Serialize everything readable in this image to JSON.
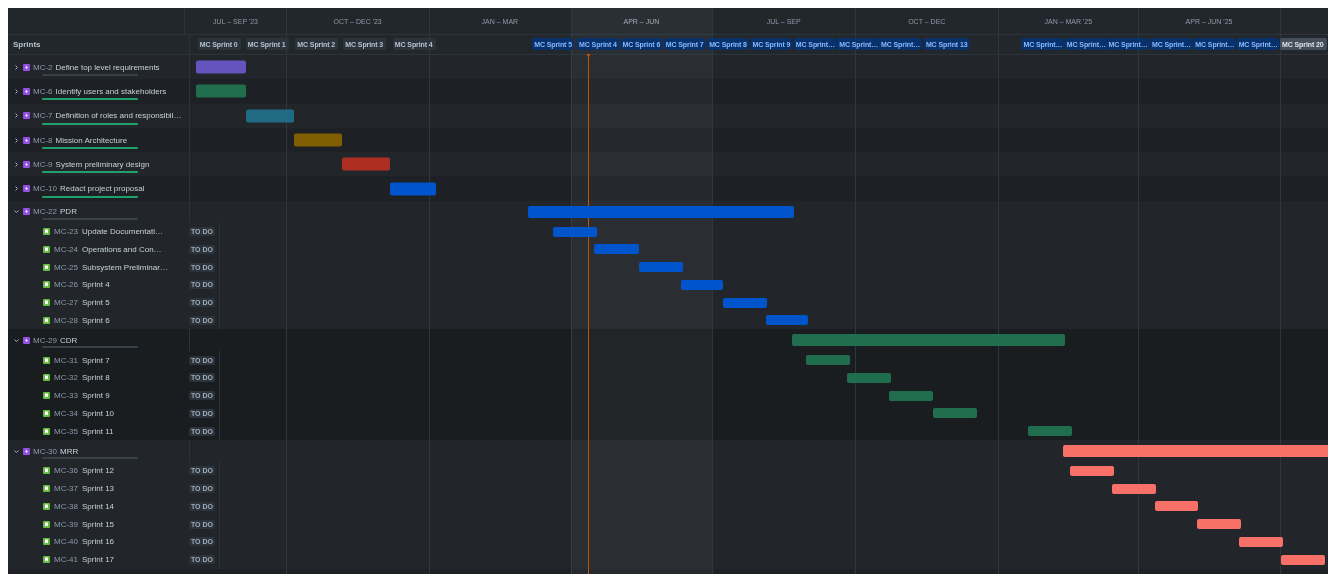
{
  "sprints_label": "Sprints",
  "quarters": [
    {
      "label": "JUL – SEP '23",
      "current": false
    },
    {
      "label": "OCT – DEC '23",
      "current": false
    },
    {
      "label": "JAN – MAR",
      "current": false
    },
    {
      "label": "APR – JUN",
      "current": true
    },
    {
      "label": "JUL – SEP",
      "current": false
    },
    {
      "label": "OCT – DEC",
      "current": false
    },
    {
      "label": "JAN – MAR '25",
      "current": false
    },
    {
      "label": "APR – JUN '25",
      "current": false
    }
  ],
  "sprints": [
    {
      "label": "MC Sprint 0",
      "kind": "closed"
    },
    {
      "label": "MC Sprint 1",
      "kind": "closed"
    },
    {
      "label": "MC Sprint 2",
      "kind": "closed"
    },
    {
      "label": "MC Sprint 3",
      "kind": "closed"
    },
    {
      "label": "MC Sprint 4",
      "kind": "closed"
    },
    {
      "label": "MC Sprint 5",
      "kind": "future"
    },
    {
      "label": "MC Sprint 4",
      "kind": "future"
    },
    {
      "label": "MC Sprint 6",
      "kind": "future"
    },
    {
      "label": "MC Sprint 7",
      "kind": "future"
    },
    {
      "label": "MC Sprint 8",
      "kind": "future"
    },
    {
      "label": "MC Sprint 9",
      "kind": "future"
    },
    {
      "label": "MC Sprint…",
      "kind": "future"
    },
    {
      "label": "MC Sprint…",
      "kind": "future"
    },
    {
      "label": "MC Sprint…",
      "kind": "future"
    },
    {
      "label": "MC Sprint 13",
      "kind": "future"
    },
    {
      "label": "MC Sprint…",
      "kind": "future"
    },
    {
      "label": "MC Sprint…",
      "kind": "future"
    },
    {
      "label": "MC Sprint…",
      "kind": "future"
    },
    {
      "label": "MC Sprint…",
      "kind": "future"
    },
    {
      "label": "MC Sprint…",
      "kind": "future"
    },
    {
      "label": "MC Sprint…",
      "kind": "future"
    },
    {
      "label": "MC Sprint 20",
      "kind": "active"
    }
  ],
  "epics": [
    {
      "key": "MC-2",
      "title": "Define top level requirements",
      "expanded": false,
      "level": 0,
      "color": "#6554c0"
    },
    {
      "key": "MC-6",
      "title": "Identify users and stakeholders",
      "expanded": false,
      "level": 1,
      "color": "#216e4e"
    },
    {
      "key": "MC-7",
      "title": "Definition of roles and responsibil…",
      "expanded": false,
      "level": 1,
      "color": "#206a83"
    },
    {
      "key": "MC-8",
      "title": "Mission Architecture",
      "expanded": false,
      "level": 1,
      "color": "#7f5f01"
    },
    {
      "key": "MC-9",
      "title": "System preliminary design",
      "expanded": false,
      "level": 1,
      "color": "#ae2e24"
    },
    {
      "key": "MC-10",
      "title": "Redact project proposal",
      "expanded": false,
      "level": 1,
      "color": "#0055cc"
    },
    {
      "key": "MC-22",
      "title": "PDR",
      "expanded": true,
      "level": 0,
      "color": "#0055cc",
      "children": [
        {
          "key": "MC-23",
          "title": "Update Documentati…",
          "status": "TO DO"
        },
        {
          "key": "MC-24",
          "title": "Operations and Con…",
          "status": "TO DO"
        },
        {
          "key": "MC-25",
          "title": "Subsystem Preliminar…",
          "status": "TO DO"
        },
        {
          "key": "MC-26",
          "title": "Sprint 4",
          "status": "TO DO"
        },
        {
          "key": "MC-27",
          "title": "Sprint 5",
          "status": "TO DO"
        },
        {
          "key": "MC-28",
          "title": "Sprint 6",
          "status": "TO DO"
        }
      ]
    },
    {
      "key": "MC-29",
      "title": "CDR",
      "expanded": true,
      "level": 0,
      "color": "#216e4e",
      "children": [
        {
          "key": "MC-31",
          "title": "Sprint 7",
          "status": "TO DO"
        },
        {
          "key": "MC-32",
          "title": "Sprint 8",
          "status": "TO DO"
        },
        {
          "key": "MC-33",
          "title": "Sprint 9",
          "status": "TO DO"
        },
        {
          "key": "MC-34",
          "title": "Sprint 10",
          "status": "TO DO"
        },
        {
          "key": "MC-35",
          "title": "Sprint 11",
          "status": "TO DO"
        }
      ]
    },
    {
      "key": "MC-30",
      "title": "MRR",
      "expanded": true,
      "level": 0,
      "color": "#f87168",
      "children": [
        {
          "key": "MC-36",
          "title": "Sprint 12",
          "status": "TO DO"
        },
        {
          "key": "MC-37",
          "title": "Sprint 13",
          "status": "TO DO"
        },
        {
          "key": "MC-38",
          "title": "Sprint 14",
          "status": "TO DO"
        },
        {
          "key": "MC-39",
          "title": "Sprint 15",
          "status": "TO DO"
        },
        {
          "key": "MC-40",
          "title": "Sprint 16",
          "status": "TO DO"
        },
        {
          "key": "MC-41",
          "title": "Sprint 17",
          "status": "TO DO"
        }
      ]
    }
  ]
}
